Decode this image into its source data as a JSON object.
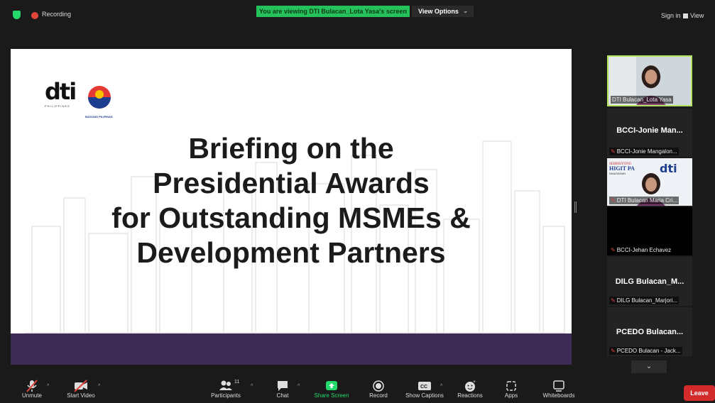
{
  "topbar": {
    "recording_label": "Recording",
    "viewing_banner": "You are viewing DTI Bulacan_Lota Yasa's screen",
    "view_options_label": "View Options",
    "sign_in_label": "Sign in",
    "view_label": "View"
  },
  "slide": {
    "title_lines": [
      "Briefing on the",
      "Presidential Awards",
      "for Outstanding MSMEs &",
      "Development Partners"
    ],
    "dti_logo_text": "dti",
    "dti_logo_sub": "PHILIPPINES",
    "bagong_pilipinas": "BAGONG PILIPINAS"
  },
  "participants": [
    {
      "display": "",
      "name": "DTI Bulacan_Lota Yasa",
      "muted": false,
      "active": true,
      "video": true
    },
    {
      "display": "BCCI-Jonie  Man...",
      "name": "BCCI-Jonie Mangalon...",
      "muted": true
    },
    {
      "display": "",
      "name": "DTI Bulacan Maria Cri...",
      "muted": true,
      "video": true,
      "bg_text": "SERBISYONG HIGIT PA INAASAHAN"
    },
    {
      "display": "",
      "name": "BCCI-Jehan Echavez",
      "muted": true,
      "video": false
    },
    {
      "display": "DILG  Bulacan_M...",
      "name": "DILG Bulacan_Marjori...",
      "muted": true
    },
    {
      "display": "PCEDO  Bulacan...",
      "name": "PCEDO Bulacan - Jack...",
      "muted": true
    }
  ],
  "toolbar": {
    "unmute": "Unmute",
    "start_video": "Start Video",
    "participants": "Participants",
    "participants_count": "11",
    "chat": "Chat",
    "share_screen": "Share Screen",
    "record": "Record",
    "show_captions": "Show Captions",
    "reactions": "Reactions",
    "apps": "Apps",
    "whiteboards": "Whiteboards",
    "leave": "Leave"
  },
  "colors": {
    "banner_green": "#25c15a",
    "slide_band": "#3d2b56",
    "leave_red": "#d32b2b",
    "active_speaker_border": "#b6e35f"
  }
}
